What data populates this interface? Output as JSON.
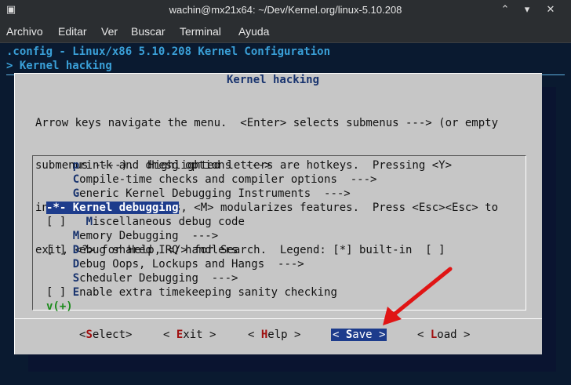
{
  "window": {
    "title": "wachin@mx21x64: ~/Dev/Kernel.org/linux-5.10.208"
  },
  "menubar": [
    "Archivo",
    "Editar",
    "Ver",
    "Buscar",
    "Terminal",
    "Ayuda"
  ],
  "header": {
    "line1": ".config - Linux/x86 5.10.208 Kernel Configuration",
    "line2": "> Kernel hacking"
  },
  "dialog": {
    "title": "Kernel hacking",
    "help": [
      "Arrow keys navigate the menu.  <Enter> selects submenus ---> (or empty",
      "submenus ----).  Highlighted letters are hotkeys.  Pressing <Y>",
      "includes, <N> excludes, <M> modularizes features.  Press <Esc><Esc> to",
      "exit, <?> for Help, </> for Search.  Legend: [*] built-in  [ ]"
    ],
    "items": [
      {
        "prefix": "    ",
        "hot": "p",
        "rest": "rintk and dmesg options  --->"
      },
      {
        "prefix": "    ",
        "hot": "C",
        "rest": "ompile-time checks and compiler options  --->"
      },
      {
        "prefix": "    ",
        "hot": "G",
        "rest": "eneric Kernel Debugging Instruments  --->"
      },
      {
        "prefix": "-*- ",
        "hot": "K",
        "rest": "ernel debugging",
        "selected": true
      },
      {
        "prefix": "[ ]   ",
        "hot": "M",
        "rest": "iscellaneous debug code"
      },
      {
        "prefix": "    ",
        "hot": "M",
        "rest": "emory Debugging  --->"
      },
      {
        "prefix": "[ ] ",
        "hot": "D",
        "rest": "ebug shared IRQ handlers"
      },
      {
        "prefix": "    ",
        "hot": "D",
        "rest": "ebug Oops, Lockups and Hangs  --->"
      },
      {
        "prefix": "    ",
        "hot": "S",
        "rest": "cheduler Debugging  --->"
      },
      {
        "prefix": "[ ] ",
        "hot": "E",
        "rest": "nable extra timekeeping sanity checking"
      }
    ],
    "more": "v(+)",
    "buttons": [
      {
        "pre": "<",
        "hot": "S",
        "post": "elect>"
      },
      {
        "pre": "< ",
        "hot": "E",
        "post": "xit >"
      },
      {
        "pre": "< ",
        "hot": "H",
        "post": "elp >"
      },
      {
        "pre": "< ",
        "hot": "S",
        "post": "ave >",
        "active": true
      },
      {
        "pre": "< ",
        "hot": "L",
        "post": "oad >"
      }
    ]
  },
  "colors": {
    "arrow": "#e01515",
    "selection": "#1d3c8c",
    "hotkey": "#18336e"
  }
}
